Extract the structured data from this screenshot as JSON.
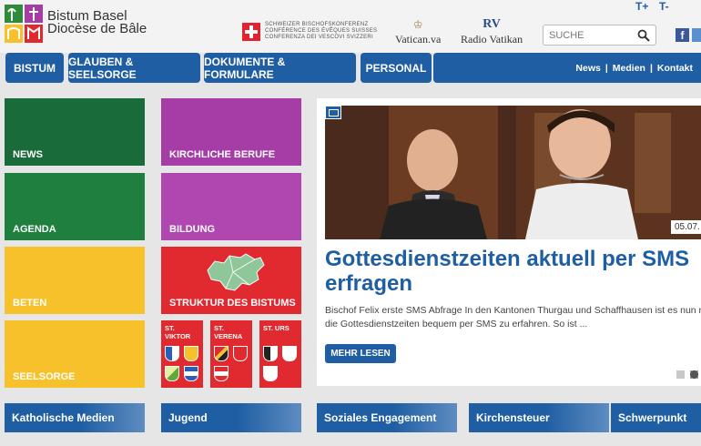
{
  "header": {
    "logo_line1": "Bistum Basel",
    "logo_line2": "Diocèse de Bâle",
    "sbk_lines": [
      "SCHWEIZER BISCHOFSKONFERENZ",
      "CONFÉRENCE DES ÉVÊQUES SUISSES",
      "CONFERENZA DEI VESCOVI SVIZZERI"
    ],
    "vatican_label": "Vatican.va",
    "radio_logo": "RV",
    "radio_label": "Radio Vatikan",
    "search_placeholder": "SUCHE",
    "font_increase": "T+",
    "font_decrease": "T-",
    "facebook_letter": "f"
  },
  "nav": {
    "items": [
      "BISTUM",
      "GLAUBEN & SEELSORGE",
      "DOKUMENTE & FORMULARE",
      "PERSONAL"
    ],
    "right_links": [
      "News",
      "Medien",
      "Kontakt"
    ],
    "separator": "|"
  },
  "tiles": {
    "news": "NEWS",
    "agenda": "AGENDA",
    "beten": "BETEN",
    "seelsorge": "SEELSORGE",
    "kirchliche_berufe": "KIRCHLICHE BERUFE",
    "bildung": "BILDUNG",
    "struktur": "STRUKTUR DES BISTUMS"
  },
  "regions": [
    {
      "line1": "ST.",
      "line2": "VIKTOR"
    },
    {
      "line1": "ST.",
      "line2": "VERENA"
    },
    {
      "line1": "ST. URS",
      "line2": ""
    }
  ],
  "slide": {
    "date": "05.07.",
    "title_line1": "Gottesdienstzeiten aktuell per SMS",
    "title_line2": "erfragen",
    "text_line1": "Bischof Felix erste SMS Abfrage In den Kantonen Thurgau und Schaffhausen ist es nun mög",
    "text_line2": "die Gottesdienstzeiten bequem per SMS zu erfahren. So ist ...",
    "more_label": "MEHR LESEN"
  },
  "bottom": [
    "Katholische Medien",
    "Jugend",
    "Soziales Engagement",
    "Kirchensteuer",
    "Schwerpunkt"
  ],
  "colors": {
    "blue": "#1f5ea3",
    "green": "#1a6b3a",
    "purple": "#a63ca6",
    "yellow": "#f6c12a",
    "red": "#e02a2f"
  }
}
